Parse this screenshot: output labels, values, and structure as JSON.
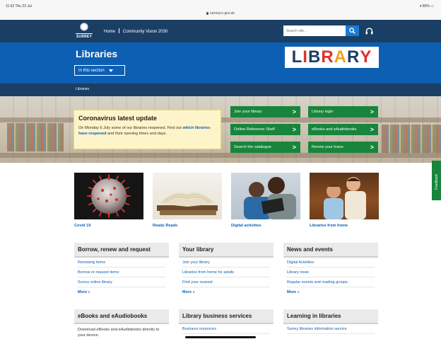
{
  "status_bar": {
    "time": "11:52  Thu 23 Jul",
    "url": "surreycc.gov.uk",
    "battery": "▾ 80% ▭"
  },
  "nav": {
    "logo_text": "SURREY",
    "links": [
      "Home",
      "Community Vision 2030"
    ],
    "search_placeholder": "Search site..."
  },
  "header": {
    "title": "Libraries",
    "section_button": "In this section",
    "library_sign": [
      "L",
      "I",
      "B",
      "R",
      "A",
      "R",
      "Y"
    ],
    "library_sign_colors": [
      "#1b3f64",
      "#e0312a",
      "#1b3f64",
      "#e0312a",
      "#f0a21b",
      "#1b3f64",
      "#e0312a"
    ]
  },
  "breadcrumb": "Libraries",
  "notice": {
    "title": "Coronavirus latest update",
    "text_before": "On Monday 6 July some of our libraries reopened. Find out ",
    "link_text": "which libraries have reopened",
    "text_after": " and their opening times and days."
  },
  "quick_links": [
    "Join your library",
    "Library login",
    "Online Reference Shelf",
    "eBooks and eAudiobooks",
    "Search the catalogue",
    "Renew your loans"
  ],
  "feedback": "Feedback",
  "tiles": [
    "Covid 19",
    "Ready Reads",
    "Digital activities",
    "Libraries from home"
  ],
  "boxes": [
    {
      "title": "Borrow, renew and request",
      "items": [
        "Renewing items",
        "Borrow or request items",
        "Surrey online library"
      ],
      "more": "More »"
    },
    {
      "title": "Your library",
      "items": [
        "Join your library",
        "Libraries from home for adults",
        "Find your nearest"
      ],
      "more": "More »"
    },
    {
      "title": "News and events",
      "items": [
        "Digital Activities",
        "Library news",
        "Regular events and reading groups"
      ],
      "more": "More »"
    },
    {
      "title": "eBooks and eAudiobooks",
      "desc": "Download eBooks and eAudiobooks directly to your device."
    },
    {
      "title": "Library business services",
      "items": [
        "Business resources"
      ]
    },
    {
      "title": "Learning in libraries",
      "items": [
        "Surrey libraries information service"
      ]
    }
  ],
  "colors": {
    "navy": "#1b3f64",
    "blue": "#0d5fb3",
    "green": "#17853b",
    "notice": "#fdf5c9"
  }
}
